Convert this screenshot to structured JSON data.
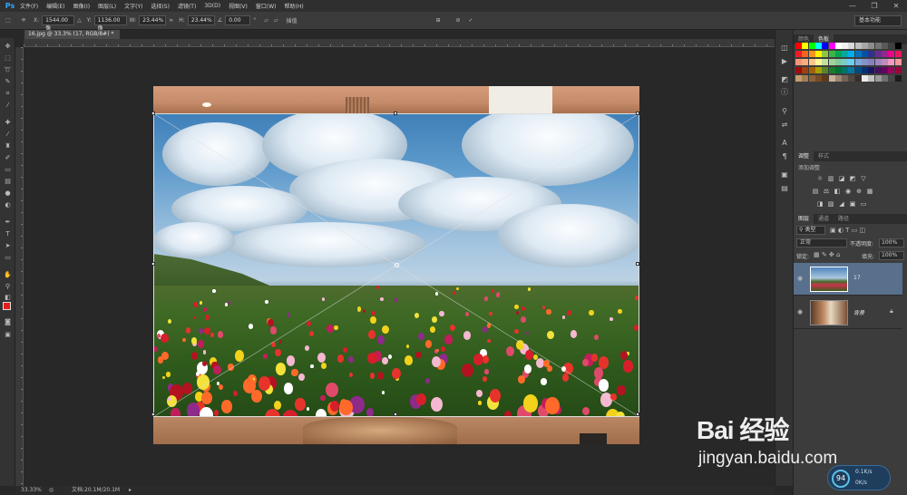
{
  "app": {
    "logo": "Ps"
  },
  "menu": [
    "文件(F)",
    "编辑(E)",
    "图像(I)",
    "图层(L)",
    "文字(Y)",
    "选择(S)",
    "滤镜(T)",
    "3D(D)",
    "视图(V)",
    "窗口(W)",
    "帮助(H)"
  ],
  "window_controls": {
    "minimize": "—",
    "restore": "❐",
    "close": "✕"
  },
  "options": {
    "x_label": "X:",
    "x_value": "1544.00 像",
    "y_label": "Y:",
    "y_value": "1136.00 像",
    "w_label": "W:",
    "w_value": "23.44%",
    "h_label": "H:",
    "h_value": "23.44%",
    "angle_value": "0.00",
    "interp_label": "插值",
    "workspace": "基本功能"
  },
  "document_tab": {
    "title": "16.jpg @ 33.3% (17, RGB/8#) *",
    "close": "×"
  },
  "status": {
    "zoom": "33.33%",
    "doc_size": "文档:20.1M/20.1M"
  },
  "panels": {
    "color_tabs": [
      "颜色",
      "色板"
    ],
    "adjust_tabs": [
      "调整",
      "样式"
    ],
    "adjust_title": "添加调整",
    "layer_tabs": [
      "图层",
      "通道",
      "路径"
    ],
    "filter_kind": "类型",
    "blend_mode": "正常",
    "opacity_label": "不透明度:",
    "opacity_value": "100%",
    "lock_label": "锁定:",
    "fill_label": "填充:",
    "fill_value": "100%",
    "layers": [
      {
        "name": "17",
        "selected": true
      },
      {
        "name": "背景",
        "selected": false
      }
    ]
  },
  "watermark": {
    "logo": "Bai 经验",
    "url": "jingyan.baidu.com"
  },
  "perf_widget": {
    "percent": "94",
    "up": "0.1K/s",
    "down": "0K/s"
  },
  "colors": {
    "accent": "#31a8ff",
    "selected_layer": "#59708d"
  }
}
